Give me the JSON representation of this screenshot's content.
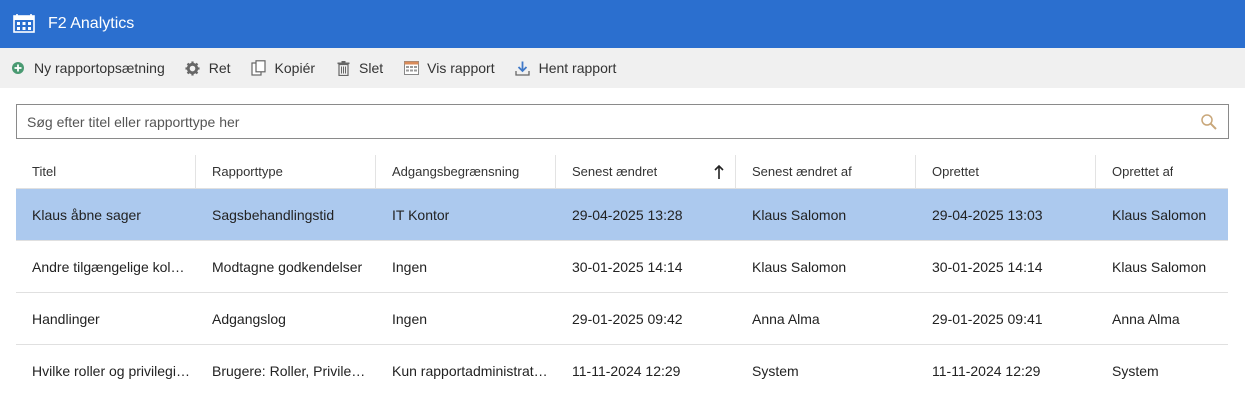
{
  "app": {
    "title": "F2 Analytics",
    "icon": "report-grid-icon"
  },
  "toolbar": {
    "new_label": "Ny rapportopsætning",
    "edit_label": "Ret",
    "copy_label": "Kopiér",
    "delete_label": "Slet",
    "view_label": "Vis rapport",
    "download_label": "Hent rapport"
  },
  "search": {
    "placeholder": "Søg efter titel eller rapporttype her"
  },
  "table": {
    "columns": [
      "Titel",
      "Rapporttype",
      "Adgangsbegrænsning",
      "Senest ændret",
      "Senest ændret af",
      "Oprettet",
      "Oprettet af"
    ],
    "sort_column": "Senest ændret",
    "rows": [
      [
        "Klaus åbne sager",
        "Sagsbehandlingstid",
        "IT Kontor",
        "29-04-2025 13:28",
        "Klaus Salomon",
        "29-04-2025 13:03",
        "Klaus Salomon"
      ],
      [
        "Andre tilgængelige kolonner",
        "Modtagne godkendelser",
        "Ingen",
        "30-01-2025 14:14",
        "Klaus Salomon",
        "30-01-2025 14:14",
        "Klaus Salomon"
      ],
      [
        "Handlinger",
        "Adgangslog",
        "Ingen",
        "29-01-2025 09:42",
        "Anna Alma",
        "29-01-2025 09:41",
        "Anna Alma"
      ],
      [
        "Hvilke roller og privilegier har brugerne",
        "Brugere: Roller, Privilegier",
        "Kun rapportadministratorer",
        "11-11-2024 12:29",
        "System",
        "11-11-2024 12:29",
        "System"
      ]
    ],
    "selected_row": 0
  },
  "colors": {
    "titlebar": "#2b6fcf",
    "selected_row": "#acc9ee",
    "toolbar_bg": "#f0f0f0"
  }
}
